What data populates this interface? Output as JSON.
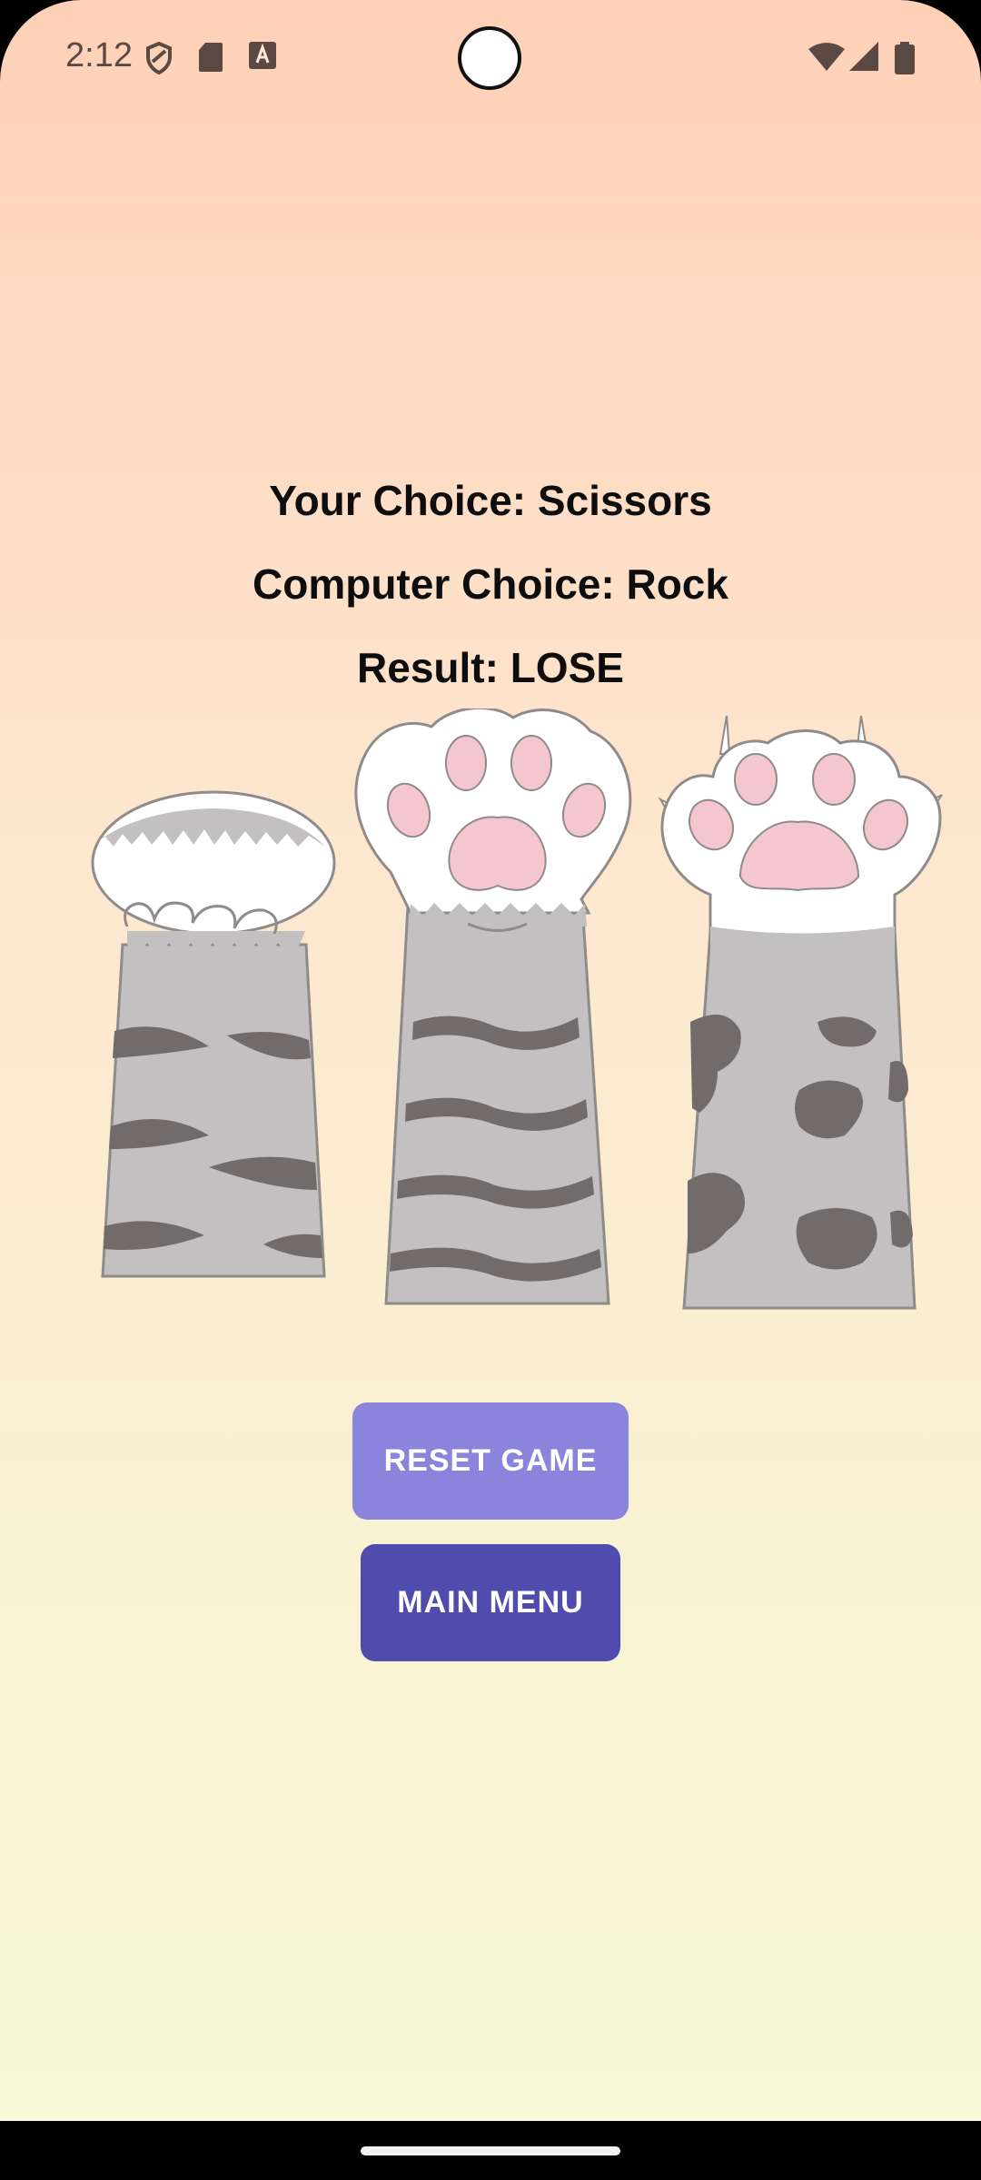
{
  "status_bar": {
    "time": "2:12",
    "icons": [
      "shield-icon",
      "sd-card-icon",
      "text-a-icon",
      "wifi-icon",
      "signal-icon",
      "battery-icon"
    ]
  },
  "game": {
    "your_choice": "Your Choice: Scissors",
    "computer_choice": "Computer Choice: Rock",
    "result": "Result: LOSE"
  },
  "paws": [
    "rock-paw-icon",
    "paper-paw-icon",
    "scissors-paw-icon"
  ],
  "buttons": {
    "reset_label": "RESET GAME",
    "menu_label": "MAIN MENU"
  },
  "colors": {
    "reset_button": "#8a84dc",
    "menu_button": "#504cad",
    "paw_pad": "#f3c6d0",
    "fur": "#c2c0c0",
    "stripe": "#716b6b"
  }
}
